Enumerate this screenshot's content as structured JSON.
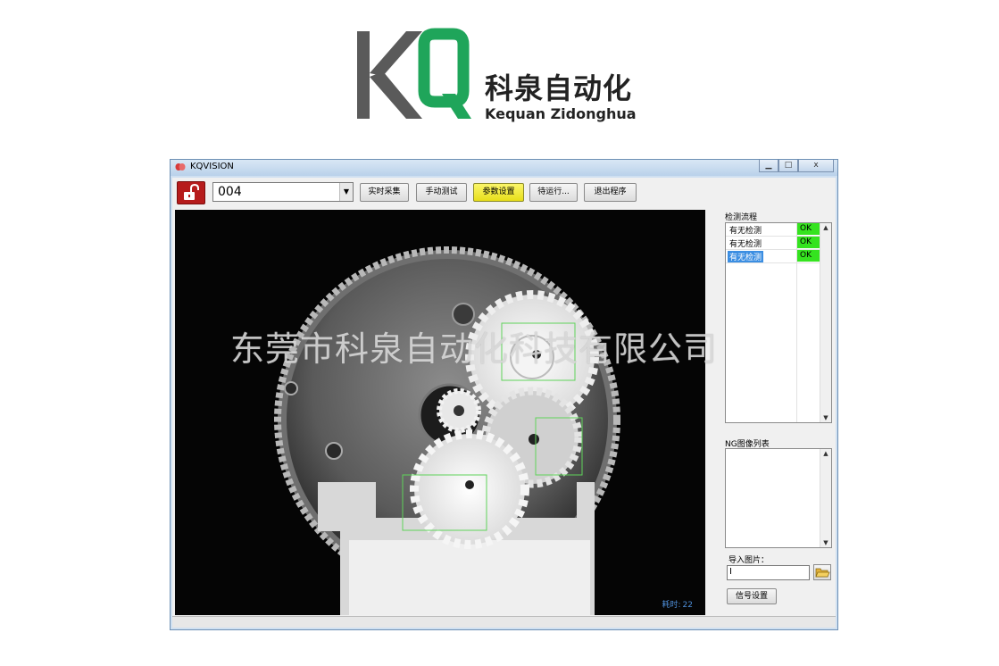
{
  "logo": {
    "letters": "KQ",
    "chinese": "科泉自动化",
    "english": "Kequan Zidonghua"
  },
  "window": {
    "title": "KQVISION",
    "minimize": "▁",
    "maximize": "□",
    "close": "x"
  },
  "toolbar": {
    "program": "004",
    "buttons": [
      "实时采集",
      "手动测试",
      "参数设置",
      "待运行...",
      "退出程序"
    ],
    "active_button": "参数设置",
    "active_color": "#f2ea32"
  },
  "viewer": {
    "elapsed_label": "耗时:",
    "elapsed_value": "22"
  },
  "watermark": "东莞市科泉自动化科技有限公司",
  "process": {
    "title": "检测流程",
    "rows": [
      {
        "name": "有无检测",
        "result": "OK"
      },
      {
        "name": "有无检测",
        "result": "OK"
      },
      {
        "name": "有无检测",
        "result": "OK"
      }
    ],
    "selected_row": 2,
    "ok_color": "#35e31f"
  },
  "ng_list": {
    "title": "NG图像列表"
  },
  "import": {
    "label": "导入图片：",
    "value": ""
  },
  "signal_button": "信号设置",
  "colors": {
    "logo_gray": "#5a5a5a",
    "logo_green": "#1fa55a",
    "lock_red": "#b61c1c",
    "roi_green": "#5fd35a"
  }
}
